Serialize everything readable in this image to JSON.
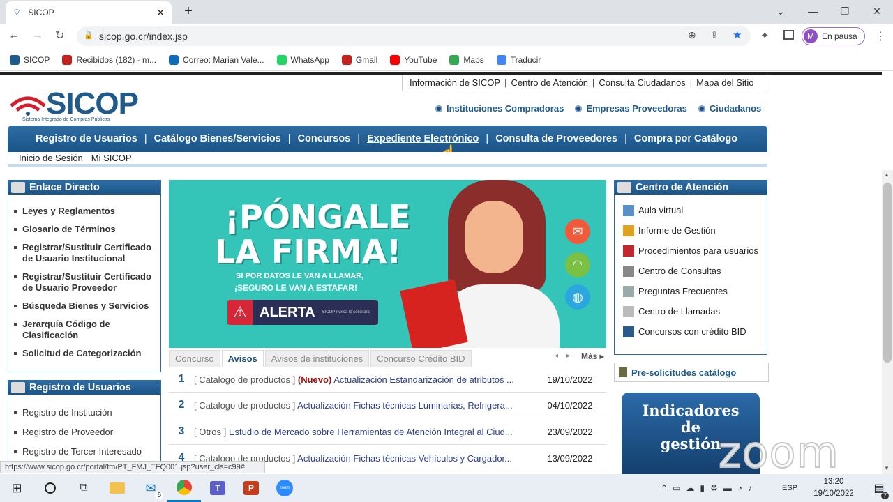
{
  "browser": {
    "tab_title": "SICOP",
    "url": "sicop.go.cr/index.jsp",
    "profile_label": "En pausa",
    "profile_initial": "M",
    "bookmarks": [
      {
        "label": "SICOP",
        "color": "#1f5a8a"
      },
      {
        "label": "Recibidos (182) - m...",
        "color": "#c5221f"
      },
      {
        "label": "Correo: Marian Vale...",
        "color": "#0f6cbd"
      },
      {
        "label": "WhatsApp",
        "color": "#25d366"
      },
      {
        "label": "Gmail",
        "color": "#c5221f"
      },
      {
        "label": "YouTube",
        "color": "#ff0000"
      },
      {
        "label": "Maps",
        "color": "#34a853"
      },
      {
        "label": "Traducir",
        "color": "#4285f4"
      }
    ]
  },
  "site": {
    "logo_text": "SICOP",
    "logo_sub": "Sistema Integrado de Compras Públicas",
    "top_links": [
      "Información de SICOP",
      "Centro de Atención",
      "Consulta Ciudadanos",
      "Mapa del Sitio"
    ],
    "role_links": [
      "Instituciones Compradoras",
      "Empresas Proveedoras",
      "Ciudadanos"
    ],
    "main_nav": [
      "Registro de Usuarios",
      "Catálogo Bienes/Servicios",
      "Concursos",
      "Expediente Electrónico",
      "Consulta de Proveedores",
      "Compra por Catálogo"
    ],
    "sub_nav": [
      "Inicio de Sesión",
      "Mi SICOP"
    ]
  },
  "enlace": {
    "title": "Enlace Directo",
    "items": [
      "Leyes y Reglamentos",
      "Glosario de Términos",
      "Registrar/Sustituir Certificado de Usuario Institucional",
      "Registrar/Sustituir Certificado de Usuario Proveedor",
      "Búsqueda Bienes y Servicios",
      "Jerarquía Código de Clasificación",
      "Solicitud de Categorización"
    ]
  },
  "registro": {
    "title": "Registro de Usuarios",
    "items": [
      "Registro de Institución",
      "Registro de Proveedor",
      "Registro de Tercer Interesado"
    ]
  },
  "banner": {
    "line1": "¡PÓNGALE",
    "line2": "LA FIRMA!",
    "line3": "SI POR DATOS LE VAN A LLAMAR,",
    "line4": "¡SEGURO LE VAN A ESTAFAR!",
    "alert": "ALERTA",
    "alert_note": "SICOP nunca le solicitará"
  },
  "notices": {
    "tabs": [
      "Concurso",
      "Avisos",
      "Avisos de instituciones",
      "Concurso Crédito BID"
    ],
    "more": "Más",
    "rows": [
      {
        "n": "1",
        "cat": "[ Catalogo de productos ]",
        "nuevo": "(Nuevo)",
        "text": "Actualización Estandarización de atributos ...",
        "date": "19/10/2022"
      },
      {
        "n": "2",
        "cat": "[ Catalogo de productos ]",
        "nuevo": "",
        "text": "Actualización Fichas técnicas Luminarias, Refrigera...",
        "date": "04/10/2022"
      },
      {
        "n": "3",
        "cat": "[ Otros ]",
        "nuevo": "",
        "text": "Estudio de Mercado sobre Herramientas de Atención Integral al Ciud...",
        "date": "23/09/2022"
      },
      {
        "n": "4",
        "cat": "[ Catalogo de productos ]",
        "nuevo": "",
        "text": "Actualización Fichas técnicas Vehículos y Cargador...",
        "date": "13/09/2022"
      }
    ]
  },
  "atencion": {
    "title": "Centro de Atención",
    "items": [
      "Aula virtual",
      "Informe de Gestión",
      "Procedimientos para usuarios",
      "Centro de Consultas",
      "Preguntas Frecuentes",
      "Centro de Llamadas",
      "Concursos con crédito BID"
    ]
  },
  "presol": {
    "title": "Pre-solicitudes catálogo"
  },
  "indicadores": {
    "line1": "Indicadores",
    "line2": "de",
    "line3": "gestión"
  },
  "zoom_watermark": "zoom",
  "status_url": "https://www.sicop.go.cr/portal/fm/PT_FMJ_TFQ001.jsp?user_cls=c99#",
  "taskbar": {
    "time": "13:20",
    "date": "19/10/2022",
    "lang": "ESP",
    "mail_badge": "6",
    "notif_badge": "7"
  }
}
